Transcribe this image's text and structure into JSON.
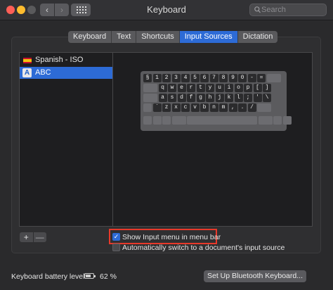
{
  "window": {
    "title": "Keyboard",
    "search_placeholder": "Search",
    "nav_back": "‹",
    "nav_forward": "›"
  },
  "tabs": [
    {
      "label": "Keyboard"
    },
    {
      "label": "Text"
    },
    {
      "label": "Shortcuts"
    },
    {
      "label": "Input Sources",
      "active": true
    },
    {
      "label": "Dictation"
    }
  ],
  "sources": [
    {
      "label": "Spanish - ISO",
      "icon": "spain-flag-icon"
    },
    {
      "label": "ABC",
      "icon": "abc-icon",
      "selected": true
    }
  ],
  "abc_icon_letter": "A",
  "keyboard": {
    "row1": [
      "§",
      "1",
      "2",
      "3",
      "4",
      "5",
      "6",
      "7",
      "8",
      "9",
      "0",
      "-",
      "="
    ],
    "row2": [
      "q",
      "w",
      "e",
      "r",
      "t",
      "y",
      "u",
      "i",
      "o",
      "p",
      "[",
      "]"
    ],
    "row3": [
      "a",
      "s",
      "d",
      "f",
      "g",
      "h",
      "j",
      "k",
      "l",
      ";",
      "'",
      "\\"
    ],
    "row4": [
      "`",
      "z",
      "x",
      "c",
      "v",
      "b",
      "n",
      "m",
      ",",
      ".",
      "/"
    ]
  },
  "list_controls": {
    "add": "+",
    "remove": "—"
  },
  "checkboxes": {
    "show_menu": {
      "label": "Show Input menu in menu bar",
      "checked": true
    },
    "auto_switch": {
      "label": "Automatically switch to a document's input source",
      "checked": false
    }
  },
  "footer": {
    "battery_label": "Keyboard battery level:",
    "battery_percent": "62 %",
    "bluetooth_button": "Set Up Bluetooth Keyboard..."
  },
  "colors": {
    "accent": "#2d6bd6",
    "highlight_box": "#e8392a"
  }
}
